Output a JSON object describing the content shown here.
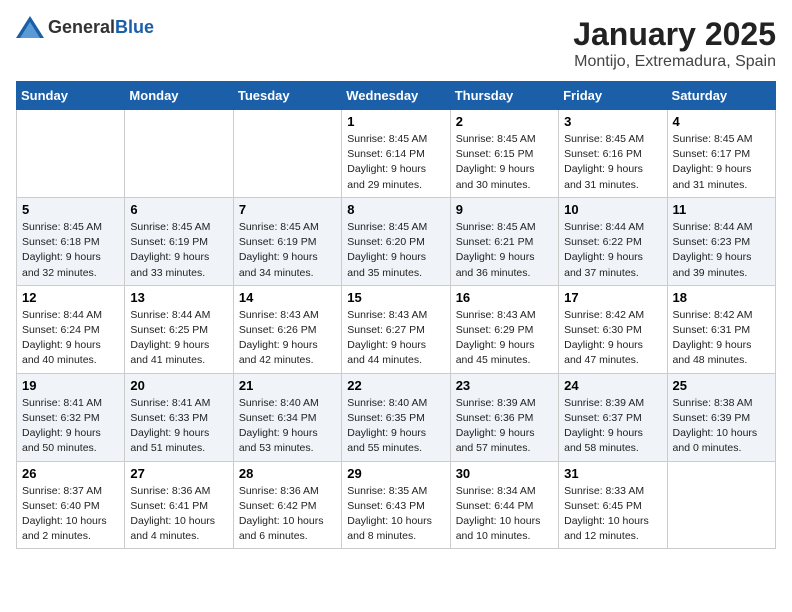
{
  "logo": {
    "general": "General",
    "blue": "Blue"
  },
  "title": "January 2025",
  "subtitle": "Montijo, Extremadura, Spain",
  "days_header": [
    "Sunday",
    "Monday",
    "Tuesday",
    "Wednesday",
    "Thursday",
    "Friday",
    "Saturday"
  ],
  "weeks": [
    [
      {
        "day": "",
        "info": ""
      },
      {
        "day": "",
        "info": ""
      },
      {
        "day": "",
        "info": ""
      },
      {
        "day": "1",
        "info": "Sunrise: 8:45 AM\nSunset: 6:14 PM\nDaylight: 9 hours and 29 minutes."
      },
      {
        "day": "2",
        "info": "Sunrise: 8:45 AM\nSunset: 6:15 PM\nDaylight: 9 hours and 30 minutes."
      },
      {
        "day": "3",
        "info": "Sunrise: 8:45 AM\nSunset: 6:16 PM\nDaylight: 9 hours and 31 minutes."
      },
      {
        "day": "4",
        "info": "Sunrise: 8:45 AM\nSunset: 6:17 PM\nDaylight: 9 hours and 31 minutes."
      }
    ],
    [
      {
        "day": "5",
        "info": "Sunrise: 8:45 AM\nSunset: 6:18 PM\nDaylight: 9 hours and 32 minutes."
      },
      {
        "day": "6",
        "info": "Sunrise: 8:45 AM\nSunset: 6:19 PM\nDaylight: 9 hours and 33 minutes."
      },
      {
        "day": "7",
        "info": "Sunrise: 8:45 AM\nSunset: 6:19 PM\nDaylight: 9 hours and 34 minutes."
      },
      {
        "day": "8",
        "info": "Sunrise: 8:45 AM\nSunset: 6:20 PM\nDaylight: 9 hours and 35 minutes."
      },
      {
        "day": "9",
        "info": "Sunrise: 8:45 AM\nSunset: 6:21 PM\nDaylight: 9 hours and 36 minutes."
      },
      {
        "day": "10",
        "info": "Sunrise: 8:44 AM\nSunset: 6:22 PM\nDaylight: 9 hours and 37 minutes."
      },
      {
        "day": "11",
        "info": "Sunrise: 8:44 AM\nSunset: 6:23 PM\nDaylight: 9 hours and 39 minutes."
      }
    ],
    [
      {
        "day": "12",
        "info": "Sunrise: 8:44 AM\nSunset: 6:24 PM\nDaylight: 9 hours and 40 minutes."
      },
      {
        "day": "13",
        "info": "Sunrise: 8:44 AM\nSunset: 6:25 PM\nDaylight: 9 hours and 41 minutes."
      },
      {
        "day": "14",
        "info": "Sunrise: 8:43 AM\nSunset: 6:26 PM\nDaylight: 9 hours and 42 minutes."
      },
      {
        "day": "15",
        "info": "Sunrise: 8:43 AM\nSunset: 6:27 PM\nDaylight: 9 hours and 44 minutes."
      },
      {
        "day": "16",
        "info": "Sunrise: 8:43 AM\nSunset: 6:29 PM\nDaylight: 9 hours and 45 minutes."
      },
      {
        "day": "17",
        "info": "Sunrise: 8:42 AM\nSunset: 6:30 PM\nDaylight: 9 hours and 47 minutes."
      },
      {
        "day": "18",
        "info": "Sunrise: 8:42 AM\nSunset: 6:31 PM\nDaylight: 9 hours and 48 minutes."
      }
    ],
    [
      {
        "day": "19",
        "info": "Sunrise: 8:41 AM\nSunset: 6:32 PM\nDaylight: 9 hours and 50 minutes."
      },
      {
        "day": "20",
        "info": "Sunrise: 8:41 AM\nSunset: 6:33 PM\nDaylight: 9 hours and 51 minutes."
      },
      {
        "day": "21",
        "info": "Sunrise: 8:40 AM\nSunset: 6:34 PM\nDaylight: 9 hours and 53 minutes."
      },
      {
        "day": "22",
        "info": "Sunrise: 8:40 AM\nSunset: 6:35 PM\nDaylight: 9 hours and 55 minutes."
      },
      {
        "day": "23",
        "info": "Sunrise: 8:39 AM\nSunset: 6:36 PM\nDaylight: 9 hours and 57 minutes."
      },
      {
        "day": "24",
        "info": "Sunrise: 8:39 AM\nSunset: 6:37 PM\nDaylight: 9 hours and 58 minutes."
      },
      {
        "day": "25",
        "info": "Sunrise: 8:38 AM\nSunset: 6:39 PM\nDaylight: 10 hours and 0 minutes."
      }
    ],
    [
      {
        "day": "26",
        "info": "Sunrise: 8:37 AM\nSunset: 6:40 PM\nDaylight: 10 hours and 2 minutes."
      },
      {
        "day": "27",
        "info": "Sunrise: 8:36 AM\nSunset: 6:41 PM\nDaylight: 10 hours and 4 minutes."
      },
      {
        "day": "28",
        "info": "Sunrise: 8:36 AM\nSunset: 6:42 PM\nDaylight: 10 hours and 6 minutes."
      },
      {
        "day": "29",
        "info": "Sunrise: 8:35 AM\nSunset: 6:43 PM\nDaylight: 10 hours and 8 minutes."
      },
      {
        "day": "30",
        "info": "Sunrise: 8:34 AM\nSunset: 6:44 PM\nDaylight: 10 hours and 10 minutes."
      },
      {
        "day": "31",
        "info": "Sunrise: 8:33 AM\nSunset: 6:45 PM\nDaylight: 10 hours and 12 minutes."
      },
      {
        "day": "",
        "info": ""
      }
    ]
  ]
}
